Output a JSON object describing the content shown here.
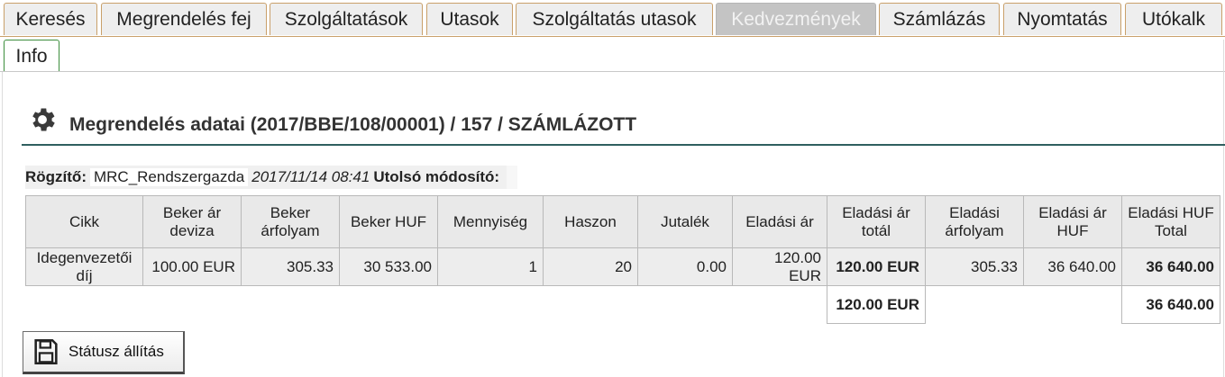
{
  "tabs": [
    {
      "label": "Keresés",
      "state": "normal"
    },
    {
      "label": "Megrendelés fej",
      "state": "normal"
    },
    {
      "label": "Szolgáltatások",
      "state": "normal"
    },
    {
      "label": "Utasok",
      "state": "normal"
    },
    {
      "label": "Szolgáltatás utasok",
      "state": "normal"
    },
    {
      "label": "Kedvezmények",
      "state": "disabled"
    },
    {
      "label": "Számlázás",
      "state": "normal"
    },
    {
      "label": "Nyomtatás",
      "state": "normal"
    },
    {
      "label": "Utókalk",
      "state": "normal"
    },
    {
      "label": "Info",
      "state": "active"
    }
  ],
  "header": {
    "title": "Megrendelés adatai (2017/BBE/108/00001) / 157 / SZÁMLÁZOTT",
    "icon": "gear-icon"
  },
  "info": {
    "recorder_label": "Rögzítő:",
    "recorder_value": "MRC_Rendszergazda",
    "recorded_at": "2017/11/14 08:41",
    "last_modifier_label": "Utolsó módosító:",
    "last_modifier_value": ""
  },
  "table": {
    "columns": [
      "Cikk",
      "Beker ár deviza",
      "Beker árfolyam",
      "Beker HUF",
      "Mennyiség",
      "Haszon",
      "Jutalék",
      "Eladási ár",
      "Eladási ár totál",
      "Eladási árfolyam",
      "Eladási ár HUF",
      "Eladási HUF Total"
    ],
    "rows": [
      [
        "Idegenvezetői díj",
        "100.00 EUR",
        "305.33",
        "30 533.00",
        "1",
        "20",
        "0.00",
        "120.00 EUR",
        "120.00 EUR",
        "305.33",
        "36 640.00",
        "36 640.00"
      ]
    ],
    "totals": {
      "sell_total": "120.00 EUR",
      "huf_total": "36 640.00"
    }
  },
  "actions": {
    "status_button": "Státusz állítás",
    "status_icon": "floppy-disk-icon"
  },
  "colors": {
    "tab_border": "#c9a06a",
    "active_tab_border": "#3d8e3d",
    "title_rule": "#2f5f5f"
  }
}
